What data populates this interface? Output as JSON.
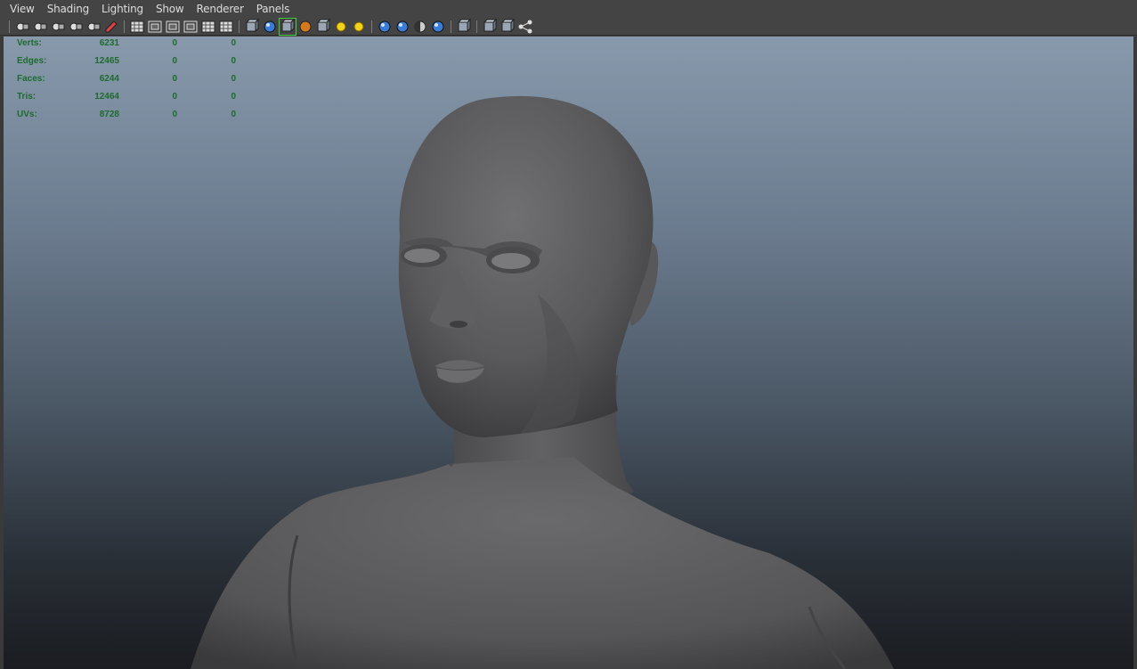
{
  "menu": [
    "View",
    "Shading",
    "Lighting",
    "Show",
    "Renderer",
    "Panels"
  ],
  "toolbar_icons": [
    [
      "camera-select-icon",
      "camera-attributes-icon",
      "bookmarks-icon",
      "image-plane-icon",
      "2d-pan-zoom-icon",
      "grease-pencil-icon"
    ],
    [
      "grid-icon",
      "film-gate-icon",
      "resolution-gate-icon",
      "gate-mask-icon",
      "field-chart-icon",
      "safe-title-icon"
    ],
    [
      "wireframe-icon",
      "smooth-shade-icon",
      "wireframe-on-shaded-icon",
      "xray-icon",
      "textured-icon",
      "default-light-icon",
      "all-lights-icon"
    ],
    [
      "shadows-icon",
      "screen-space-ao-icon",
      "motion-blur-icon",
      "multisample-aa-icon"
    ],
    [
      "isolate-select-icon"
    ],
    [
      "xray-joints-icon",
      "xray-active-icon",
      "node-editor-icon"
    ]
  ],
  "hud": {
    "rows": [
      {
        "label": "Verts:",
        "total": "6231",
        "selected": "0",
        "highlighted": "0"
      },
      {
        "label": "Edges:",
        "total": "12465",
        "selected": "0",
        "highlighted": "0"
      },
      {
        "label": "Faces:",
        "total": "6244",
        "selected": "0",
        "highlighted": "0"
      },
      {
        "label": "Tris:",
        "total": "12464",
        "selected": "0",
        "highlighted": "0"
      },
      {
        "label": "UVs:",
        "total": "8728",
        "selected": "0",
        "highlighted": "0"
      }
    ]
  },
  "colors": {
    "accent_active": "#3fd03f",
    "hud_text": "#1d6b2e",
    "model_skin": "#5c5c5e"
  }
}
